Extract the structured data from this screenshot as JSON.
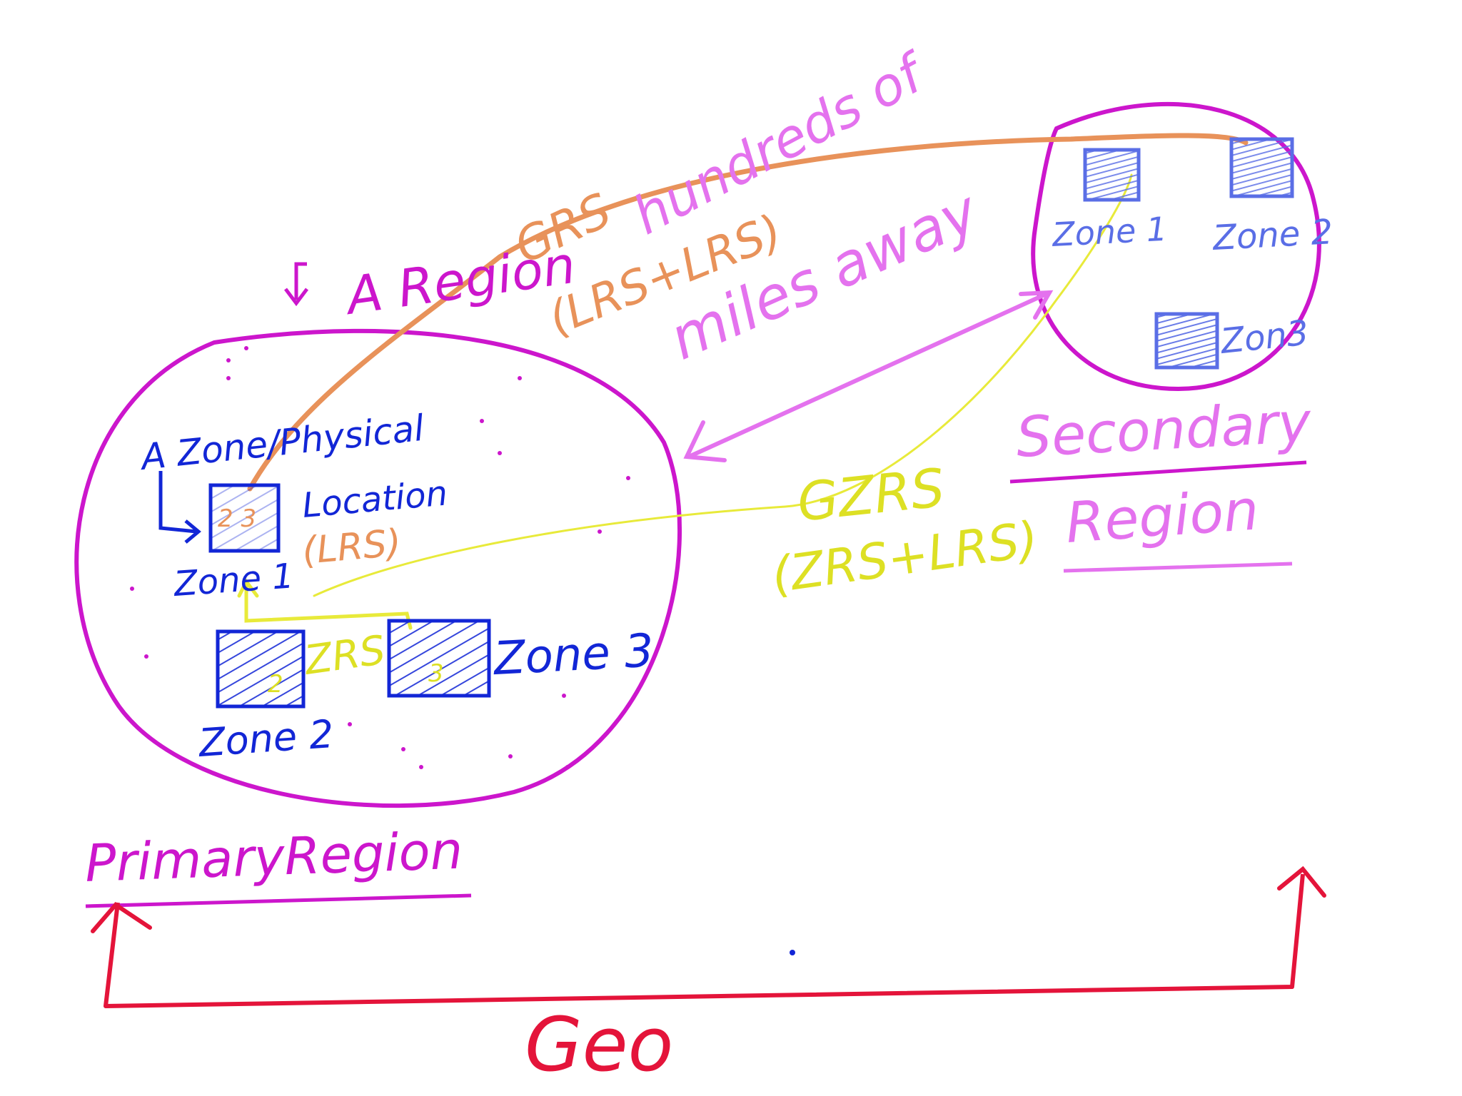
{
  "colors": {
    "region_circle": "#cc16cc",
    "zone": "#1226d6",
    "secondary_zone": "#5a6ee6",
    "grs": "#e8925a",
    "zrs_gzrs": "#dde024",
    "distance": "#e472ee",
    "geo": "#e4143a"
  },
  "labels": {
    "a_region": "A Region",
    "a_zone_physical": "A Zone/Physical",
    "location": "Location",
    "lrs": "(LRS)",
    "primary_zone1": "Zone 1",
    "primary_zone2": "Zone 2",
    "primary_zone3": "Zone 3",
    "zrs": "ZRS",
    "grs": "GRS",
    "grs_formula": "(LRS+LRS)",
    "hundreds_of": "hundreds of",
    "miles_away": "miles away",
    "gzrs": "GZRS",
    "gzrs_formula": "(ZRS+LRS)",
    "secondary_zone1": "Zone 1",
    "secondary_zone2": "Zone 2",
    "secondary_zone3": "Zon3",
    "secondary_region_line1": "Secondary",
    "secondary_region_line2": "Region",
    "primary_region": "PrimaryRegion",
    "geo": "Geo",
    "zone1_marks": "2 3",
    "zone2_mark": "2",
    "zone3_mark": "3"
  },
  "icons": [
    "zone-box",
    "arrow-head"
  ]
}
